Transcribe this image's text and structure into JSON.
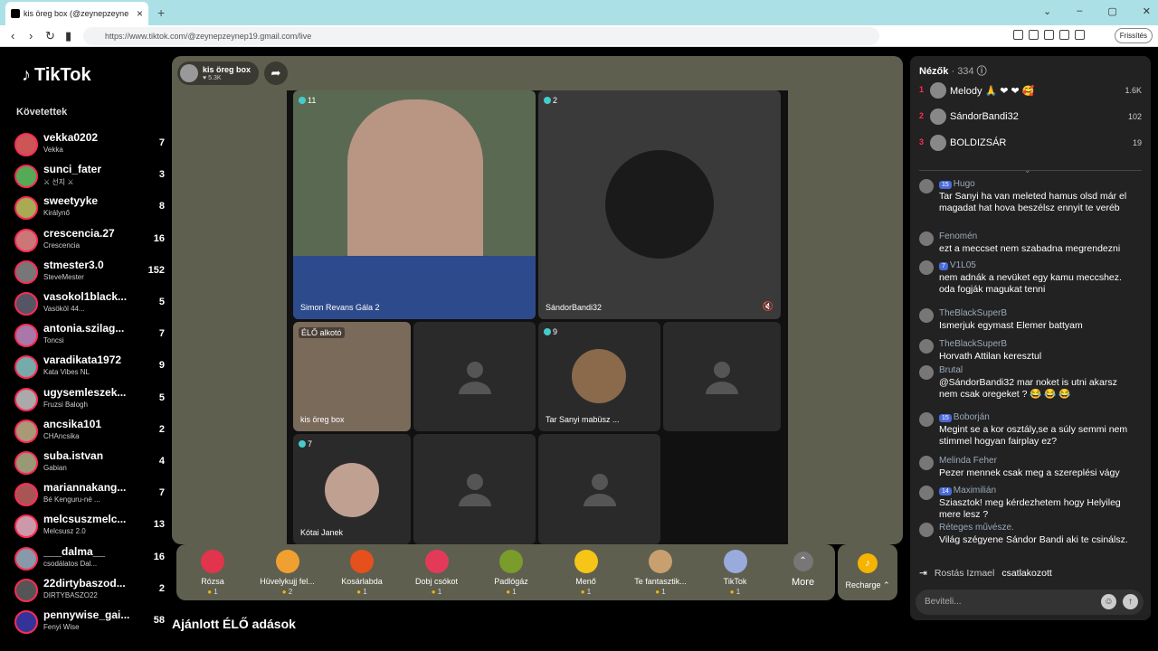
{
  "browser": {
    "tab_title": "kis öreg box (@zeynepzeyne",
    "url": "https://www.tiktok.com/@zeynepzeynep19.gmail.com/live",
    "refresh_label": "Frissítés"
  },
  "sidebar": {
    "brand": "TikTok",
    "section": "Követettek",
    "items": [
      {
        "name": "vekka0202",
        "sub": "Vekka",
        "count": "7"
      },
      {
        "name": "sunci_fater",
        "sub": "⚔ 선지 ⚔",
        "count": "3"
      },
      {
        "name": "sweetyyke",
        "sub": "Királynő",
        "count": "8"
      },
      {
        "name": "crescencia.27",
        "sub": "Crescencia",
        "count": "16"
      },
      {
        "name": "stmester3.0",
        "sub": "SteveMester",
        "count": "152"
      },
      {
        "name": "vasokol1black...",
        "sub": "Vasököl 44...",
        "count": "5"
      },
      {
        "name": "antonia.szilag...",
        "sub": "Toncsi",
        "count": "7"
      },
      {
        "name": "varadikata1972",
        "sub": "Kata Vibes NL",
        "count": "9"
      },
      {
        "name": "ugysemleszek...",
        "sub": "Fruzsi Balogh",
        "count": "5"
      },
      {
        "name": "ancsika101",
        "sub": "CHAncsika",
        "count": "2"
      },
      {
        "name": "suba.istvan",
        "sub": "Gabian",
        "count": "4"
      },
      {
        "name": "mariannakang...",
        "sub": "Bé Kenguru-né ...",
        "count": "7"
      },
      {
        "name": "melcsuszmelc...",
        "sub": "Melcsusz 2.0",
        "count": "13"
      },
      {
        "name": "___dalma__",
        "sub": "csodálatos Dal...",
        "count": "16"
      },
      {
        "name": "22dirtybaszod...",
        "sub": "DIRTYBASZO22",
        "count": "2"
      },
      {
        "name": "pennywise_gai...",
        "sub": "Fenyi Wise",
        "count": "58"
      }
    ]
  },
  "stream": {
    "host": "kis öreg box",
    "likes": "5.3K",
    "cells": [
      {
        "label": "Simon Revans Gála 2",
        "badge": "11"
      },
      {
        "label": "SándorBandi32",
        "badge": "2"
      },
      {
        "label": "kis öreg box",
        "badge": "ÉLŐ alkotó"
      },
      {
        "label": "Tar Sanyi mabüsz ...",
        "badge": "9"
      },
      {
        "label": "Kótai Janek",
        "badge": "7"
      }
    ]
  },
  "gifts": [
    {
      "label": "Rózsa",
      "cost": "1",
      "color": "#e2344c"
    },
    {
      "label": "Hüvelykujj fel...",
      "cost": "2",
      "color": "#f0a030"
    },
    {
      "label": "Kosárlabda",
      "cost": "1",
      "color": "#e5501c"
    },
    {
      "label": "Dobj csókot",
      "cost": "1",
      "color": "#e33a5a"
    },
    {
      "label": "Padlógáz",
      "cost": "1",
      "color": "#7a9c2a"
    },
    {
      "label": "Menő",
      "cost": "1",
      "color": "#f5c518"
    },
    {
      "label": "Te fantasztik...",
      "cost": "1",
      "color": "#c8a070"
    },
    {
      "label": "TikTok",
      "cost": "1",
      "color": "#9ad"
    }
  ],
  "more_label": "More",
  "recharge_label": "Recharge",
  "suggested": "Ajánlott ÉLŐ adások",
  "chat": {
    "viewers_label": "Nézők",
    "viewers_count": "· 334",
    "ranks": [
      {
        "n": "1",
        "name": "Melody 🙏 ❤ ❤ 🥰",
        "v": "1.6K"
      },
      {
        "n": "2",
        "name": "SándorBandi32",
        "v": "102"
      },
      {
        "n": "3",
        "name": "BOLDIZSÁR",
        "v": "19"
      }
    ],
    "messages": [
      {
        "user": "Hugo",
        "badge": "15",
        "text": "Tar Sanyi ha van meleted hamus olsd már el magadat hat hova beszélsz ennyit te veréb"
      },
      {
        "user": "Fenomén",
        "badge": "",
        "text": "ezt a meccset nem szabadna megrendezni"
      },
      {
        "user": "V1L05",
        "badge": "7",
        "text": "nem adnák a nevüket egy kamu meccshez. oda fogják magukat tenni"
      },
      {
        "user": "TheBlackSuperB",
        "badge": "",
        "text": "Ismerjuk egymast Elemer battyam"
      },
      {
        "user": "TheBlackSuperB",
        "badge": "",
        "text": "Horvath Attilan keresztul"
      },
      {
        "user": "Brutal",
        "badge": "",
        "text": "@SándorBandi32 mar noket is utni akarsz nem csak oregeket ? 😂 😂 😂"
      },
      {
        "user": "Boborján",
        "badge": "15",
        "text": "Megint se a kor osztály,se a súly semmi nem stimmel hogyan fairplay ez?"
      },
      {
        "user": "Melinda Feher",
        "badge": "",
        "text": "Pezer mennek csak meg a szereplési vágy"
      },
      {
        "user": "Maximilián",
        "badge": "14",
        "text": "Sziasztok! meg kérdezhetem hogy Helyileg mere lesz ?"
      },
      {
        "user": "Réteges művésze.",
        "badge": "",
        "text": "Világ szégyene Sándor Bandi aki te csinálsz."
      }
    ],
    "join_user": "Rostás Izmael",
    "join_text": "csatlakozott",
    "input_placeholder": "Beviteli..."
  }
}
